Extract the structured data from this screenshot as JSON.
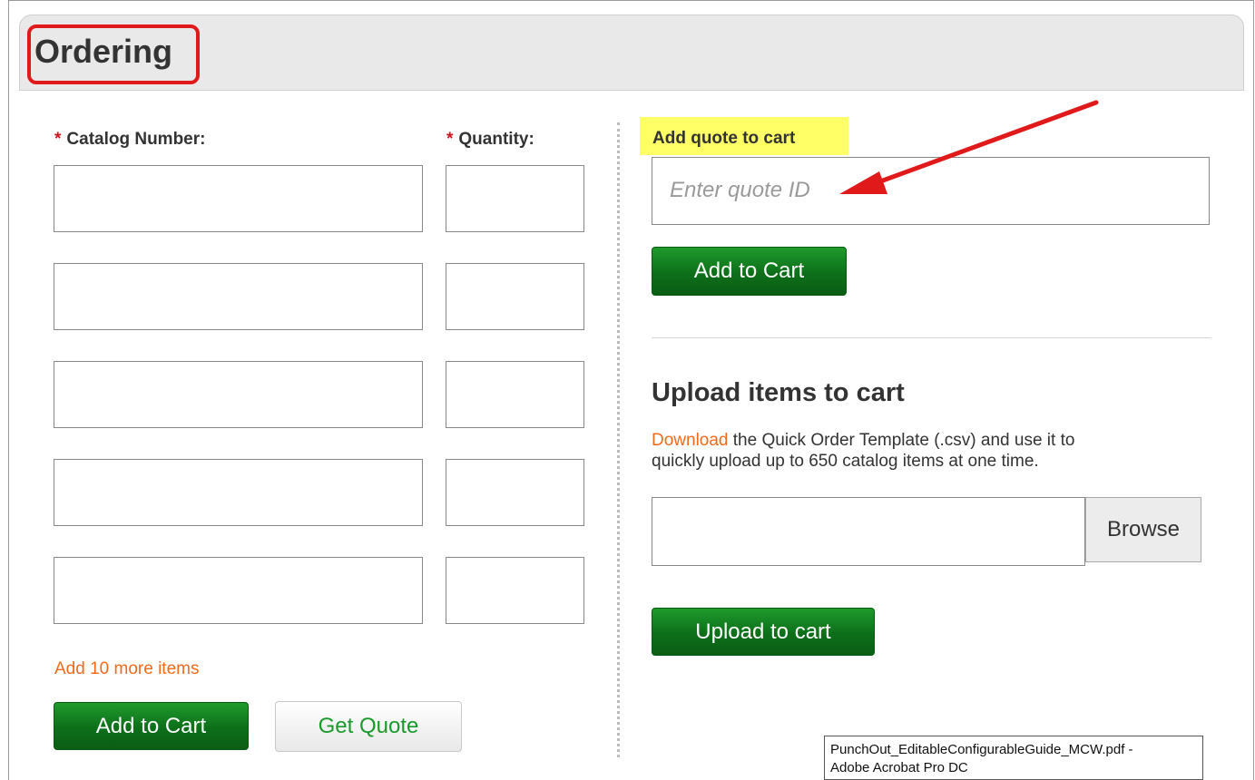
{
  "header": {
    "title": "Ordering"
  },
  "order_form": {
    "catalog_label": "Catalog Number:",
    "quantity_label": "Quantity:",
    "required_mark": "*",
    "rows": 5,
    "add_more_link": "Add 10 more items",
    "add_to_cart_label": "Add to Cart",
    "get_quote_label": "Get Quote"
  },
  "quote": {
    "heading": "Add quote to cart",
    "placeholder": "Enter quote ID",
    "add_to_cart_label": "Add to Cart"
  },
  "upload": {
    "heading": "Upload items to cart",
    "download_link": "Download",
    "description_1": " the Quick Order Template (.csv) and use it to",
    "description_2": "quickly upload up to 650 catalog items at one time.",
    "browse_label": "Browse",
    "upload_label": "Upload to cart"
  },
  "tooltip": {
    "line1": "PunchOut_EditableConfigurableGuide_MCW.pdf -",
    "line2": "Adobe Acrobat Pro DC"
  },
  "colors": {
    "accent_orange": "#f26a1b",
    "button_green": "#0d6f19",
    "required_red": "#d0121b",
    "annotation_red": "#e01a1a",
    "highlight_yellow": "#ffff66"
  }
}
